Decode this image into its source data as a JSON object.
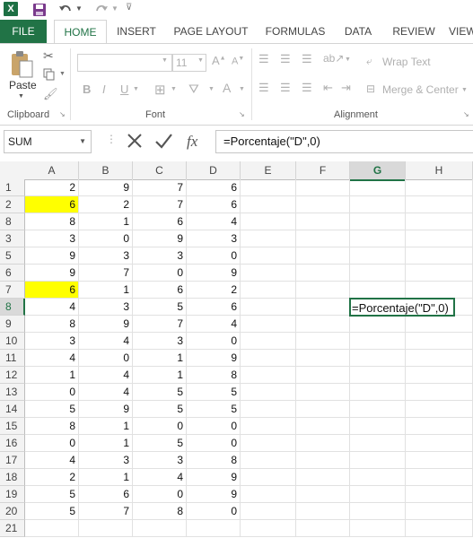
{
  "quick_access": {
    "app_icon": "X",
    "save_icon": "save-icon",
    "undo_icon": "undo-icon",
    "redo_icon": "redo-icon"
  },
  "tabs": [
    "FILE",
    "HOME",
    "INSERT",
    "PAGE LAYOUT",
    "FORMULAS",
    "DATA",
    "REVIEW",
    "VIEW"
  ],
  "ribbon": {
    "paste_label": "Paste",
    "clipboard_label": "Clipboard",
    "font_size": "11",
    "font_label": "Font",
    "wrap_text": "Wrap Text",
    "merge_center": "Merge & Center",
    "alignment_label": "Alignment",
    "bold": "B",
    "italic": "I",
    "underline": "U"
  },
  "formula_bar": {
    "name_box": "SUM",
    "fx": "fx",
    "formula": "=Porcentaje(\"D\",0)"
  },
  "columns": [
    "A",
    "B",
    "C",
    "D",
    "E",
    "F",
    "G",
    "H"
  ],
  "active_column": "G",
  "active_row": 8,
  "rows": [
    {
      "num": "1",
      "a": "2",
      "b": "9",
      "c": "7",
      "d": "6",
      "hl": false
    },
    {
      "num": "2",
      "a": "6",
      "b": "2",
      "c": "7",
      "d": "6",
      "hl": true
    },
    {
      "num": "8",
      "a": "8",
      "b": "1",
      "c": "6",
      "d": "4",
      "hl": false
    },
    {
      "num": "3",
      "a": "3",
      "b": "0",
      "c": "9",
      "d": "3",
      "hl": false
    },
    {
      "num": "5",
      "a": "9",
      "b": "3",
      "c": "3",
      "d": "0",
      "hl": false
    },
    {
      "num": "6",
      "a": "9",
      "b": "7",
      "c": "0",
      "d": "9",
      "hl": false
    },
    {
      "num": "7",
      "a": "6",
      "b": "1",
      "c": "6",
      "d": "2",
      "hl": true
    },
    {
      "num": "8",
      "a": "4",
      "b": "3",
      "c": "5",
      "d": "6",
      "hl": false
    },
    {
      "num": "9",
      "a": "8",
      "b": "9",
      "c": "7",
      "d": "4",
      "hl": false
    },
    {
      "num": "10",
      "a": "3",
      "b": "4",
      "c": "3",
      "d": "0",
      "hl": false
    },
    {
      "num": "11",
      "a": "4",
      "b": "0",
      "c": "1",
      "d": "9",
      "hl": false
    },
    {
      "num": "12",
      "a": "1",
      "b": "4",
      "c": "1",
      "d": "8",
      "hl": false
    },
    {
      "num": "13",
      "a": "0",
      "b": "4",
      "c": "5",
      "d": "5",
      "hl": false
    },
    {
      "num": "14",
      "a": "5",
      "b": "9",
      "c": "5",
      "d": "5",
      "hl": false
    },
    {
      "num": "15",
      "a": "8",
      "b": "1",
      "c": "0",
      "d": "0",
      "hl": false
    },
    {
      "num": "16",
      "a": "0",
      "b": "1",
      "c": "5",
      "d": "0",
      "hl": false
    },
    {
      "num": "17",
      "a": "4",
      "b": "3",
      "c": "3",
      "d": "8",
      "hl": false
    },
    {
      "num": "18",
      "a": "2",
      "b": "1",
      "c": "4",
      "d": "9",
      "hl": false
    },
    {
      "num": "19",
      "a": "5",
      "b": "6",
      "c": "0",
      "d": "9",
      "hl": false
    },
    {
      "num": "20",
      "a": "5",
      "b": "7",
      "c": "8",
      "d": "0",
      "hl": false
    },
    {
      "num": "21",
      "a": "",
      "b": "",
      "c": "",
      "d": "",
      "hl": false
    }
  ],
  "editing_cell": {
    "row_index": 7,
    "column": "G",
    "text": "=Porcentaje(\"D\",0)"
  },
  "colors": {
    "excel_green": "#217346",
    "highlight": "#ffff00",
    "active_header": "#d9d9d9"
  }
}
